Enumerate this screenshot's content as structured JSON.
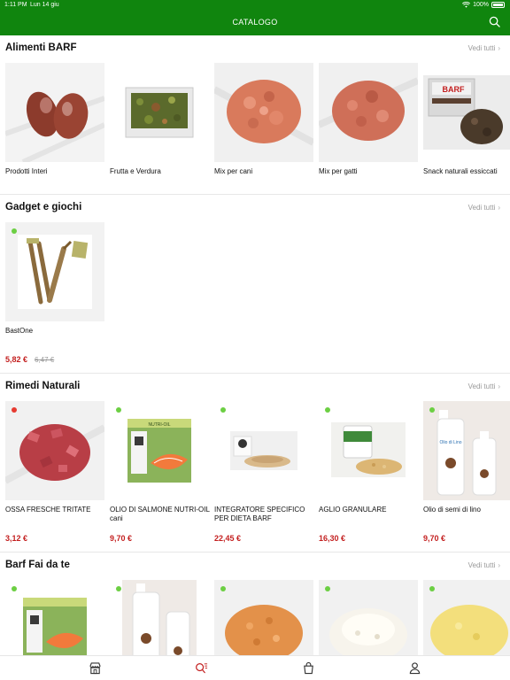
{
  "status_bar": {
    "time": "1:11 PM",
    "date": "Lun 14 giu",
    "battery": "100%"
  },
  "header": {
    "title": "CATALOGO"
  },
  "see_all_label": "Vedi tutti",
  "sections": [
    {
      "title": "Alimenti BARF",
      "items": [
        {
          "name": "Prodotti Interi"
        },
        {
          "name": "Frutta e Verdura"
        },
        {
          "name": "Mix per cani"
        },
        {
          "name": "Mix per gatti"
        },
        {
          "name": "Snack naturali essiccati"
        }
      ]
    },
    {
      "title": "Gadget e giochi",
      "items": [
        {
          "name": "BastOne",
          "price": "5,82 €",
          "old_price": "6,47 €",
          "dot": "green"
        }
      ]
    },
    {
      "title": "Rimedi Naturali",
      "items": [
        {
          "name": "OSSA FRESCHE TRITATE",
          "price": "3,12 €",
          "dot": "red"
        },
        {
          "name": "OLIO DI SALMONE NUTRI-OIL cani",
          "price": "9,70 €",
          "dot": "green"
        },
        {
          "name": "INTEGRATORE SPECIFICO PER DIETA BARF",
          "price": "22,45 €",
          "dot": "green"
        },
        {
          "name": "AGLIO GRANULARE",
          "price": "16,30 €",
          "dot": "green"
        },
        {
          "name": "Olio di semi di lino",
          "price": "9,70 €",
          "dot": "green"
        }
      ]
    },
    {
      "title": "Barf Fai da te",
      "items": [
        {
          "dot": "green"
        },
        {
          "dot": "green"
        },
        {
          "dot": "green"
        },
        {
          "dot": "green"
        },
        {
          "dot": "green"
        }
      ]
    }
  ],
  "product_label_texts": {
    "salmon_box": "NUTRI-OIL",
    "barf_box": "BARF",
    "oil_bottle": "Olio di Lino"
  },
  "tabs": [
    {
      "name": "Negozio",
      "icon": "store-icon"
    },
    {
      "name": "Catalogo",
      "icon": "catalog-search-icon",
      "active": true
    },
    {
      "name": "Carrello",
      "icon": "shopping-bag-icon"
    },
    {
      "name": "Profilo",
      "icon": "user-icon"
    }
  ],
  "colors": {
    "brand": "#10850e",
    "price": "#c31f1f",
    "status_green": "#6ccf43",
    "status_red": "#e63a30"
  }
}
